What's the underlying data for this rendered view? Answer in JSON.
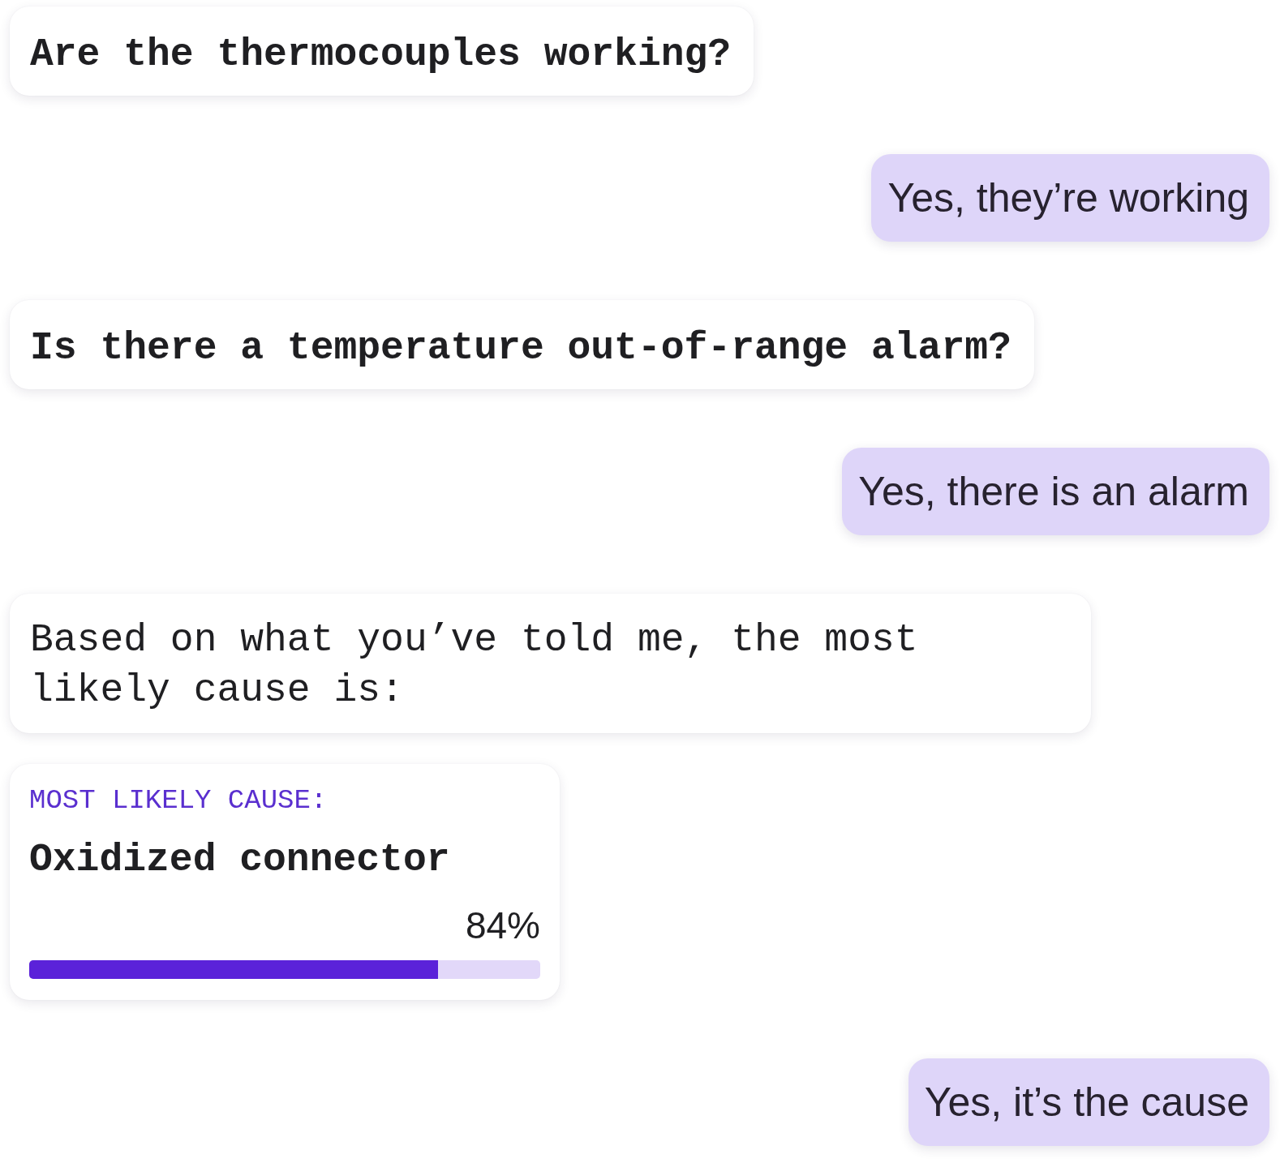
{
  "messages": [
    {
      "kind": "question",
      "text": "Are the thermocouples working?"
    },
    {
      "kind": "reply",
      "text": "Yes, they’re working"
    },
    {
      "kind": "question",
      "text": "Is there a temperature out-of-range alarm?"
    },
    {
      "kind": "reply",
      "text": "Yes, there is an alarm"
    },
    {
      "kind": "statement",
      "text": "Based on what you’ve told me, the most likely cause is:"
    },
    {
      "kind": "cause",
      "label": "MOST LIKELY CAUSE:",
      "title": "Oxidized connector",
      "percent": "84%",
      "level": 0.8
    },
    {
      "kind": "reply",
      "text": "Yes, it’s the cause"
    }
  ]
}
